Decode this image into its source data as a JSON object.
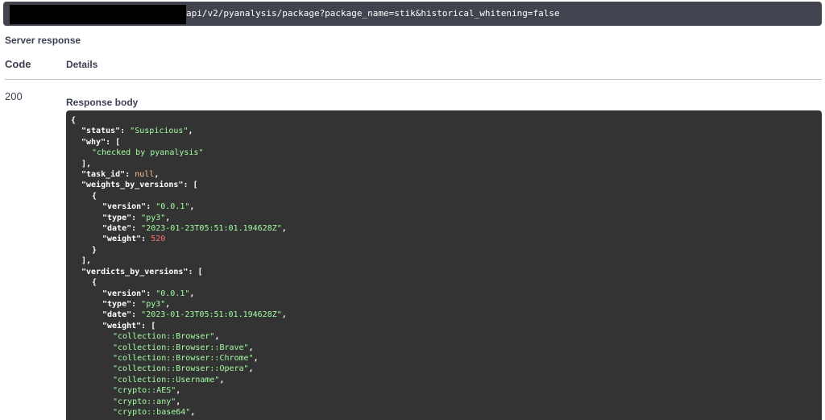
{
  "url_bar": {
    "url_suffix": "api/v2/pyanalysis/package?package_name=stik&historical_whitening=false"
  },
  "section_title": "Server response",
  "columns": {
    "code": "Code",
    "details": "Details"
  },
  "response": {
    "code": "200",
    "body_label": "Response body",
    "lines": [
      {
        "indent": 0,
        "parts": [
          [
            "p",
            "{"
          ]
        ]
      },
      {
        "indent": 1,
        "parts": [
          [
            "k",
            "\"status\""
          ],
          [
            "p",
            ": "
          ],
          [
            "s",
            "\"Suspicious\""
          ],
          [
            "p",
            ","
          ]
        ]
      },
      {
        "indent": 1,
        "parts": [
          [
            "k",
            "\"why\""
          ],
          [
            "p",
            ": ["
          ]
        ]
      },
      {
        "indent": 2,
        "parts": [
          [
            "s",
            "\"checked by pyanalysis\""
          ]
        ]
      },
      {
        "indent": 1,
        "parts": [
          [
            "p",
            "],"
          ]
        ]
      },
      {
        "indent": 1,
        "parts": [
          [
            "k",
            "\"task_id\""
          ],
          [
            "p",
            ": "
          ],
          [
            "n",
            "null"
          ],
          [
            "p",
            ","
          ]
        ]
      },
      {
        "indent": 1,
        "parts": [
          [
            "k",
            "\"weights_by_versions\""
          ],
          [
            "p",
            ": ["
          ]
        ]
      },
      {
        "indent": 2,
        "parts": [
          [
            "p",
            "{"
          ]
        ]
      },
      {
        "indent": 3,
        "parts": [
          [
            "k",
            "\"version\""
          ],
          [
            "p",
            ": "
          ],
          [
            "s",
            "\"0.0.1\""
          ],
          [
            "p",
            ","
          ]
        ]
      },
      {
        "indent": 3,
        "parts": [
          [
            "k",
            "\"type\""
          ],
          [
            "p",
            ": "
          ],
          [
            "s",
            "\"py3\""
          ],
          [
            "p",
            ","
          ]
        ]
      },
      {
        "indent": 3,
        "parts": [
          [
            "k",
            "\"date\""
          ],
          [
            "p",
            ": "
          ],
          [
            "s",
            "\"2023-01-23T05:51:01.194628Z\""
          ],
          [
            "p",
            ","
          ]
        ]
      },
      {
        "indent": 3,
        "parts": [
          [
            "k",
            "\"weight\""
          ],
          [
            "p",
            ": "
          ],
          [
            "w",
            "520"
          ]
        ]
      },
      {
        "indent": 2,
        "parts": [
          [
            "p",
            "}"
          ]
        ]
      },
      {
        "indent": 1,
        "parts": [
          [
            "p",
            "],"
          ]
        ]
      },
      {
        "indent": 1,
        "parts": [
          [
            "k",
            "\"verdicts_by_versions\""
          ],
          [
            "p",
            ": ["
          ]
        ]
      },
      {
        "indent": 2,
        "parts": [
          [
            "p",
            "{"
          ]
        ]
      },
      {
        "indent": 3,
        "parts": [
          [
            "k",
            "\"version\""
          ],
          [
            "p",
            ": "
          ],
          [
            "s",
            "\"0.0.1\""
          ],
          [
            "p",
            ","
          ]
        ]
      },
      {
        "indent": 3,
        "parts": [
          [
            "k",
            "\"type\""
          ],
          [
            "p",
            ": "
          ],
          [
            "s",
            "\"py3\""
          ],
          [
            "p",
            ","
          ]
        ]
      },
      {
        "indent": 3,
        "parts": [
          [
            "k",
            "\"date\""
          ],
          [
            "p",
            ": "
          ],
          [
            "s",
            "\"2023-01-23T05:51:01.194628Z\""
          ],
          [
            "p",
            ","
          ]
        ]
      },
      {
        "indent": 3,
        "parts": [
          [
            "k",
            "\"weight\""
          ],
          [
            "p",
            ": ["
          ]
        ]
      },
      {
        "indent": 4,
        "parts": [
          [
            "s",
            "\"collection::Browser\""
          ],
          [
            "p",
            ","
          ]
        ]
      },
      {
        "indent": 4,
        "parts": [
          [
            "s",
            "\"collection::Browser::Brave\""
          ],
          [
            "p",
            ","
          ]
        ]
      },
      {
        "indent": 4,
        "parts": [
          [
            "s",
            "\"collection::Browser::Chrome\""
          ],
          [
            "p",
            ","
          ]
        ]
      },
      {
        "indent": 4,
        "parts": [
          [
            "s",
            "\"collection::Browser::Opera\""
          ],
          [
            "p",
            ","
          ]
        ]
      },
      {
        "indent": 4,
        "parts": [
          [
            "s",
            "\"collection::Username\""
          ],
          [
            "p",
            ","
          ]
        ]
      },
      {
        "indent": 4,
        "parts": [
          [
            "s",
            "\"crypto::AES\""
          ],
          [
            "p",
            ","
          ]
        ]
      },
      {
        "indent": 4,
        "parts": [
          [
            "s",
            "\"crypto::any\""
          ],
          [
            "p",
            ","
          ]
        ]
      },
      {
        "indent": 4,
        "parts": [
          [
            "s",
            "\"crypto::base64\""
          ],
          [
            "p",
            ","
          ]
        ]
      }
    ]
  }
}
